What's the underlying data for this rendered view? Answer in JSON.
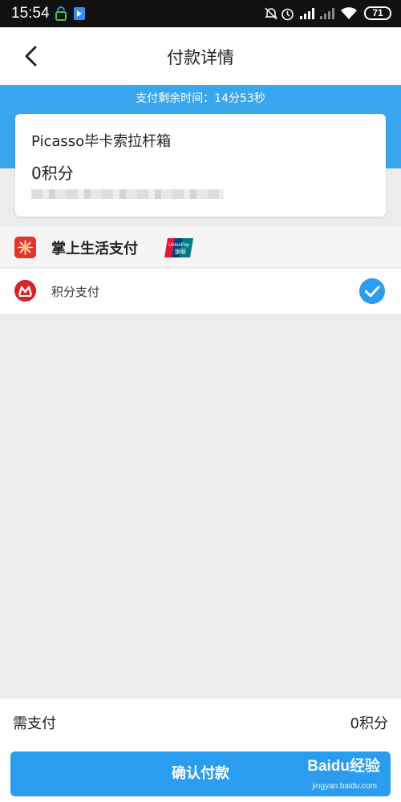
{
  "status_bar": {
    "time": "15:54",
    "battery": "71",
    "icons": [
      "lock-app-icon",
      "app-notification-icon",
      "mute-icon",
      "alarm-icon",
      "signal-icon",
      "signal-icon-secondary",
      "wifi-icon",
      "battery-icon"
    ]
  },
  "header": {
    "title": "付款详情",
    "back_icon": "chevron-left-icon"
  },
  "countdown": "支付剩余时间：14分53秒",
  "order": {
    "name": "Picasso毕卡索拉杆箱",
    "points": "0积分"
  },
  "payment_method": {
    "label": "掌上生活支付",
    "logo_icon": "zhangshang-shenghuo-logo-icon",
    "badge_icon": "unionpay-icon"
  },
  "payment_option": {
    "label": "积分支付",
    "logo_icon": "cmb-bank-logo-icon",
    "selected": true
  },
  "summary": {
    "need_label": "需支付",
    "need_value": "0积分"
  },
  "confirm_button": "确认付款",
  "watermark": {
    "text": "Baidu经验",
    "url": "jingyan.baidu.com"
  },
  "colors": {
    "accent": "#2b9df0",
    "band": "#3aa6ee",
    "background": "#ececec"
  }
}
